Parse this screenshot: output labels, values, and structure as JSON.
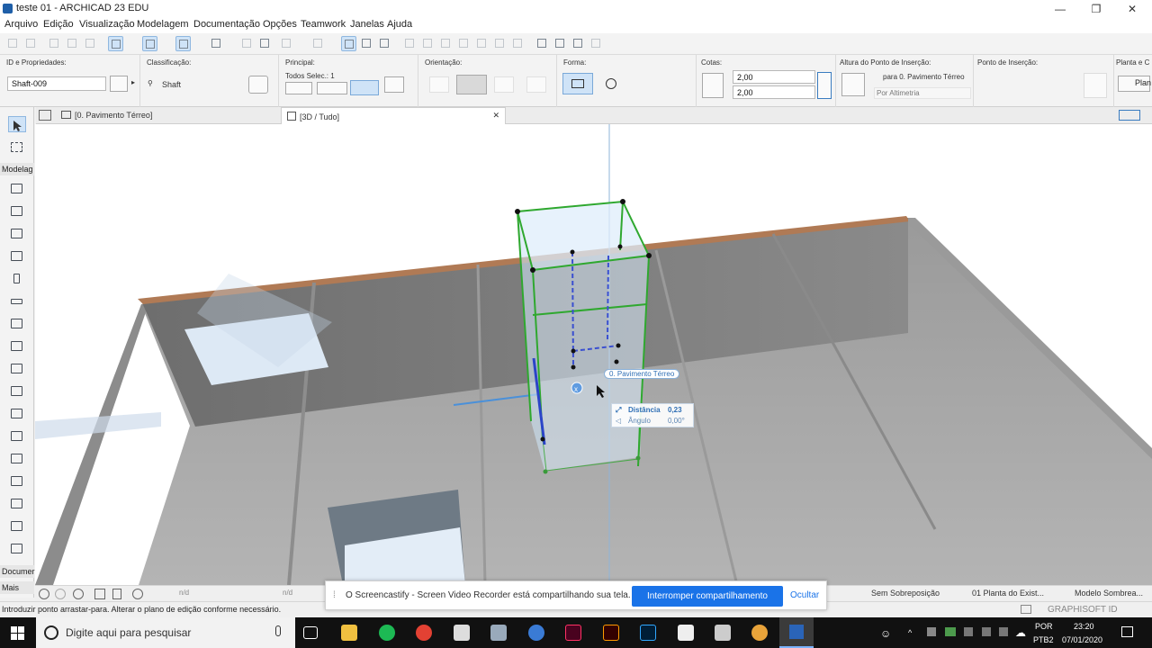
{
  "window": {
    "title": "teste 01 - ARCHICAD 23 EDU",
    "minimize": "—",
    "maximize": "❐",
    "close": "✕"
  },
  "menu": [
    "Arquivo",
    "Edição",
    "Visualização",
    "Modelagem",
    "Documentação",
    "Opções",
    "Teamwork",
    "Janelas",
    "Ajuda"
  ],
  "infobox": {
    "id_header": "ID e Propriedades:",
    "id_value": "Shaft-009",
    "class_header": "Classificação:",
    "class_value": "Shaft",
    "main_header": "Principal:",
    "main_value": "Todos Selec.: 1",
    "orient_header": "Orientação:",
    "shape_header": "Forma:",
    "dims_header": "Cotas:",
    "dim1": "2,00",
    "dim2": "2,00",
    "height_header": "Altura do Ponto de Inserção:",
    "height_story": "para 0. Pavimento Térreo",
    "height_ref": "Por Altimetria",
    "insert_header": "Ponto de Inserção:",
    "plan_header": "Planta e C",
    "plan_value": "Plan"
  },
  "tabs": {
    "plan": "[0. Pavimento Térreo]",
    "view3d": "[3D / Tudo]",
    "close": "✕"
  },
  "toolbox": {
    "section1": "Modelag",
    "section2": "Documer",
    "section3": "Mais"
  },
  "viewport": {
    "story_tag": "0. Pavimento Térreo",
    "distance_label": "Distância",
    "distance_value": "0,23",
    "angle_label": "Ângulo",
    "angle_value": "0,00°"
  },
  "navbar": {
    "nd1": "n/d",
    "nd2": "n/d",
    "overlay": "Sem Sobreposição",
    "layer": "01 Planta do Exist...",
    "model": "Modelo Sombrea..."
  },
  "status": {
    "hint": "Introduzir ponto arrastar-para. Alterar o plano de edição conforme necessário.",
    "brand": "GRAPHISOFT ID"
  },
  "castbar": {
    "message": "O Screencastify - Screen Video Recorder está compartilhando sua tela.",
    "stop": "Interromper compartilhamento",
    "hide": "Ocultar"
  },
  "taskbar": {
    "search": "Digite aqui para pesquisar",
    "lang1": "POR",
    "lang2": "PTB2",
    "time": "23:20",
    "date": "07/01/2020"
  },
  "colors": {
    "accent": "#1a73e8",
    "wall_top": "#b07a55",
    "shaft_green": "#2fa82f"
  }
}
